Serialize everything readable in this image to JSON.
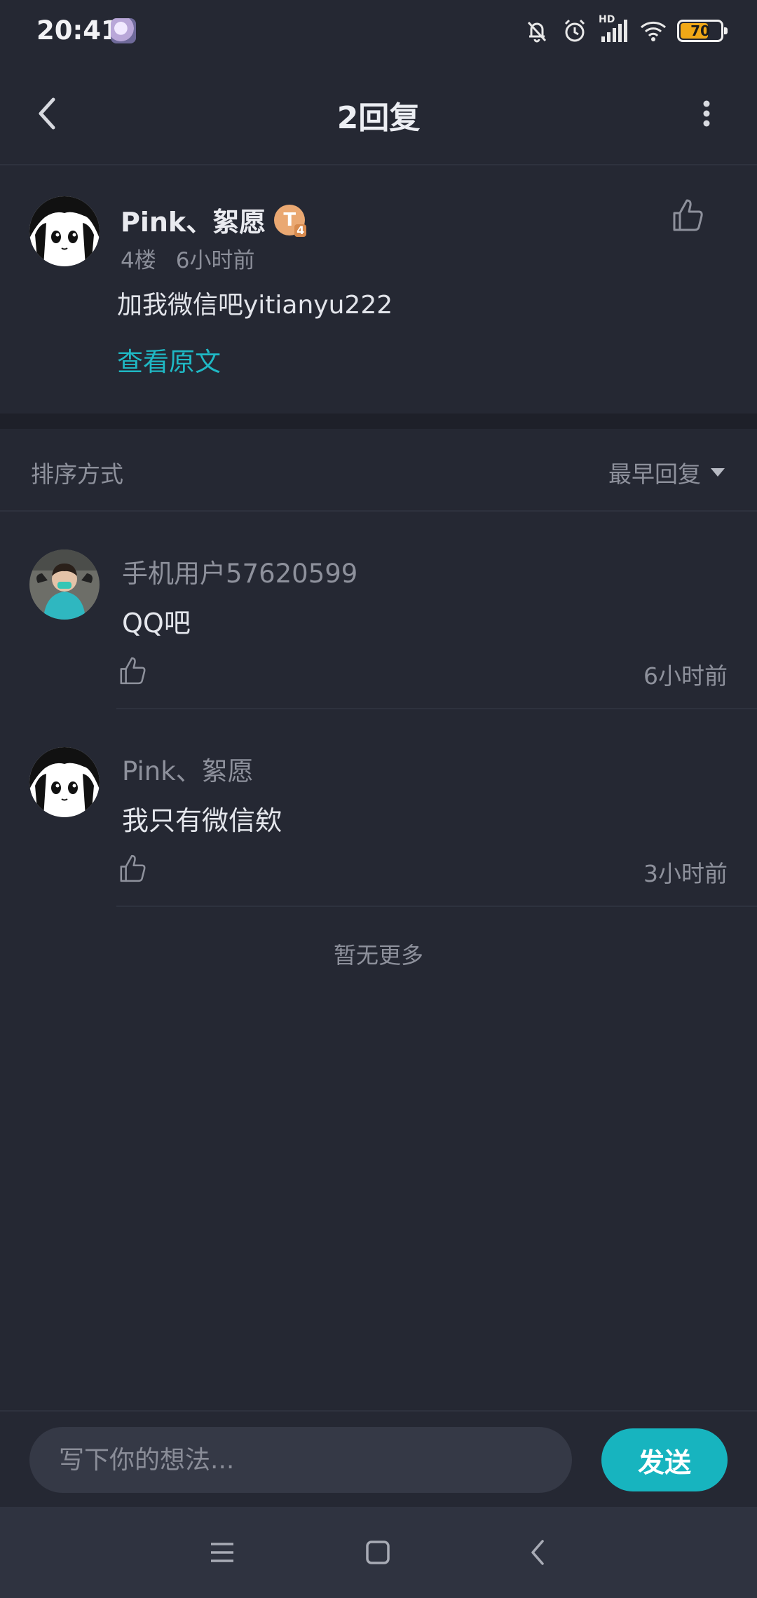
{
  "status_bar": {
    "time": "20:41",
    "network_label": "HD",
    "battery_level": 70,
    "battery_text": "70",
    "icons": [
      "app-notification-icon",
      "mute-bell-icon",
      "alarm-icon",
      "signal-icon",
      "wifi-icon",
      "battery-icon"
    ]
  },
  "header": {
    "title": "2回复",
    "back_icon": "chevron-left-icon",
    "more_icon": "more-vertical-icon"
  },
  "post": {
    "author": "Pink、絮愿",
    "badge_letter": "T",
    "badge_sub": "4",
    "floor": "4楼",
    "time": "6小时前",
    "content": "加我微信吧yitianyu222",
    "view_original": "查看原文",
    "like_icon": "thumbs-up-icon"
  },
  "sort": {
    "label": "排序方式",
    "selected": "最早回复"
  },
  "replies": [
    {
      "author": "手机用户57620599",
      "text": "QQ吧",
      "time": "6小时前"
    },
    {
      "author": "Pink、絮愿",
      "text": "我只有微信欸",
      "time": "3小时前"
    }
  ],
  "footer_note": "暂无更多",
  "composer": {
    "placeholder": "写下你的想法...",
    "send_label": "发送"
  },
  "colors": {
    "background": "#252833",
    "accent": "#17b4bf",
    "link": "#1fb8c4",
    "muted_text": "#8e919c",
    "badge": "#eaa872",
    "battery": "#f0a817"
  },
  "nav_bar": {
    "icons": [
      "menu-icon",
      "home-square-icon",
      "back-triangle-icon"
    ]
  }
}
